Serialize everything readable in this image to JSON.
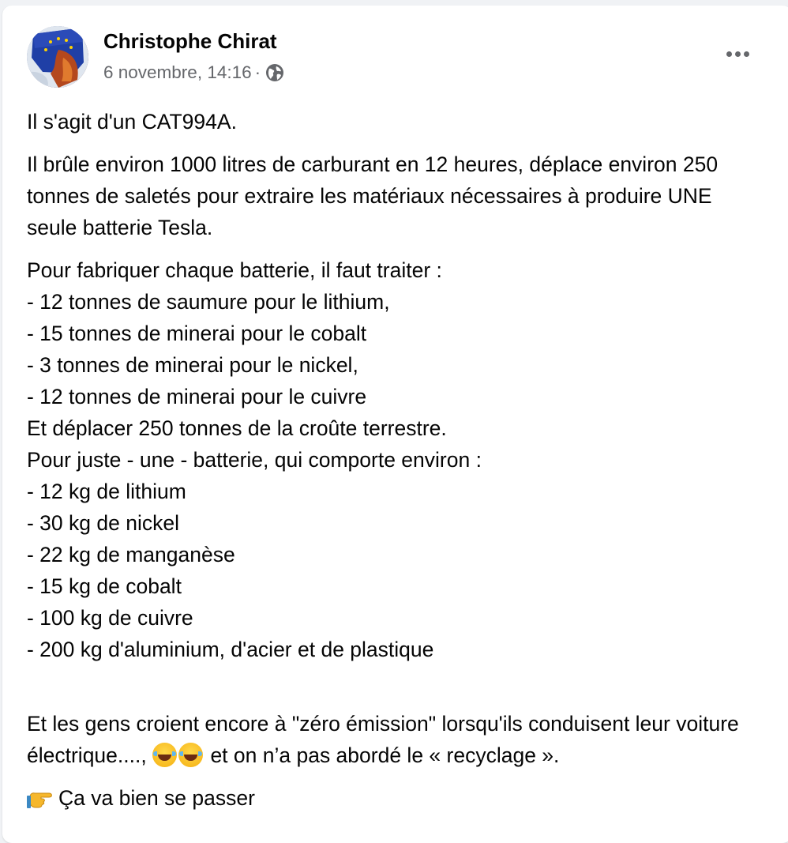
{
  "post": {
    "author": "Christophe Chirat",
    "date": "6 novembre, 14:16",
    "separator": "·",
    "privacy_icon": "globe-icon",
    "more_icon": "more-options-icon"
  },
  "content": {
    "p1": "Il s'agit d'un CAT994A.",
    "p2": "Il brûle environ 1000 litres de carburant en 12 heures, déplace environ 250 tonnes de saletés pour extraire les matériaux nécessaires à produire UNE seule batterie Tesla.",
    "p3": "Pour fabriquer chaque batterie, il faut traiter :\n- 12 tonnes de saumure pour le lithium,\n- 15 tonnes de minerai pour le cobalt\n- 3 tonnes de minerai pour le nickel,\n- 12 tonnes de minerai pour le cuivre\nEt déplacer 250 tonnes de la croûte terrestre.\nPour juste - une - batterie, qui comporte environ :\n- 12 kg de lithium\n- 30 kg de nickel\n- 22 kg de manganèse\n- 15 kg de cobalt\n- 100 kg de cuivre\n- 200 kg d'aluminium, d'acier et de plastique",
    "p4_start": "Et les gens croient encore à \"zéro émission\" lorsqu'ils conduisent leur voiture électrique...., ",
    "p4_emoji": "laughing-tears-emoji",
    "p4_end": " et on n’a pas abordé le « recyclage ».",
    "p5_icon": "pointing-hand-emoji",
    "p5": "Ça va bien se passer"
  },
  "colors": {
    "background": "#f0f2f5",
    "card": "#ffffff",
    "text": "#050505",
    "secondary_text": "#65676b"
  }
}
